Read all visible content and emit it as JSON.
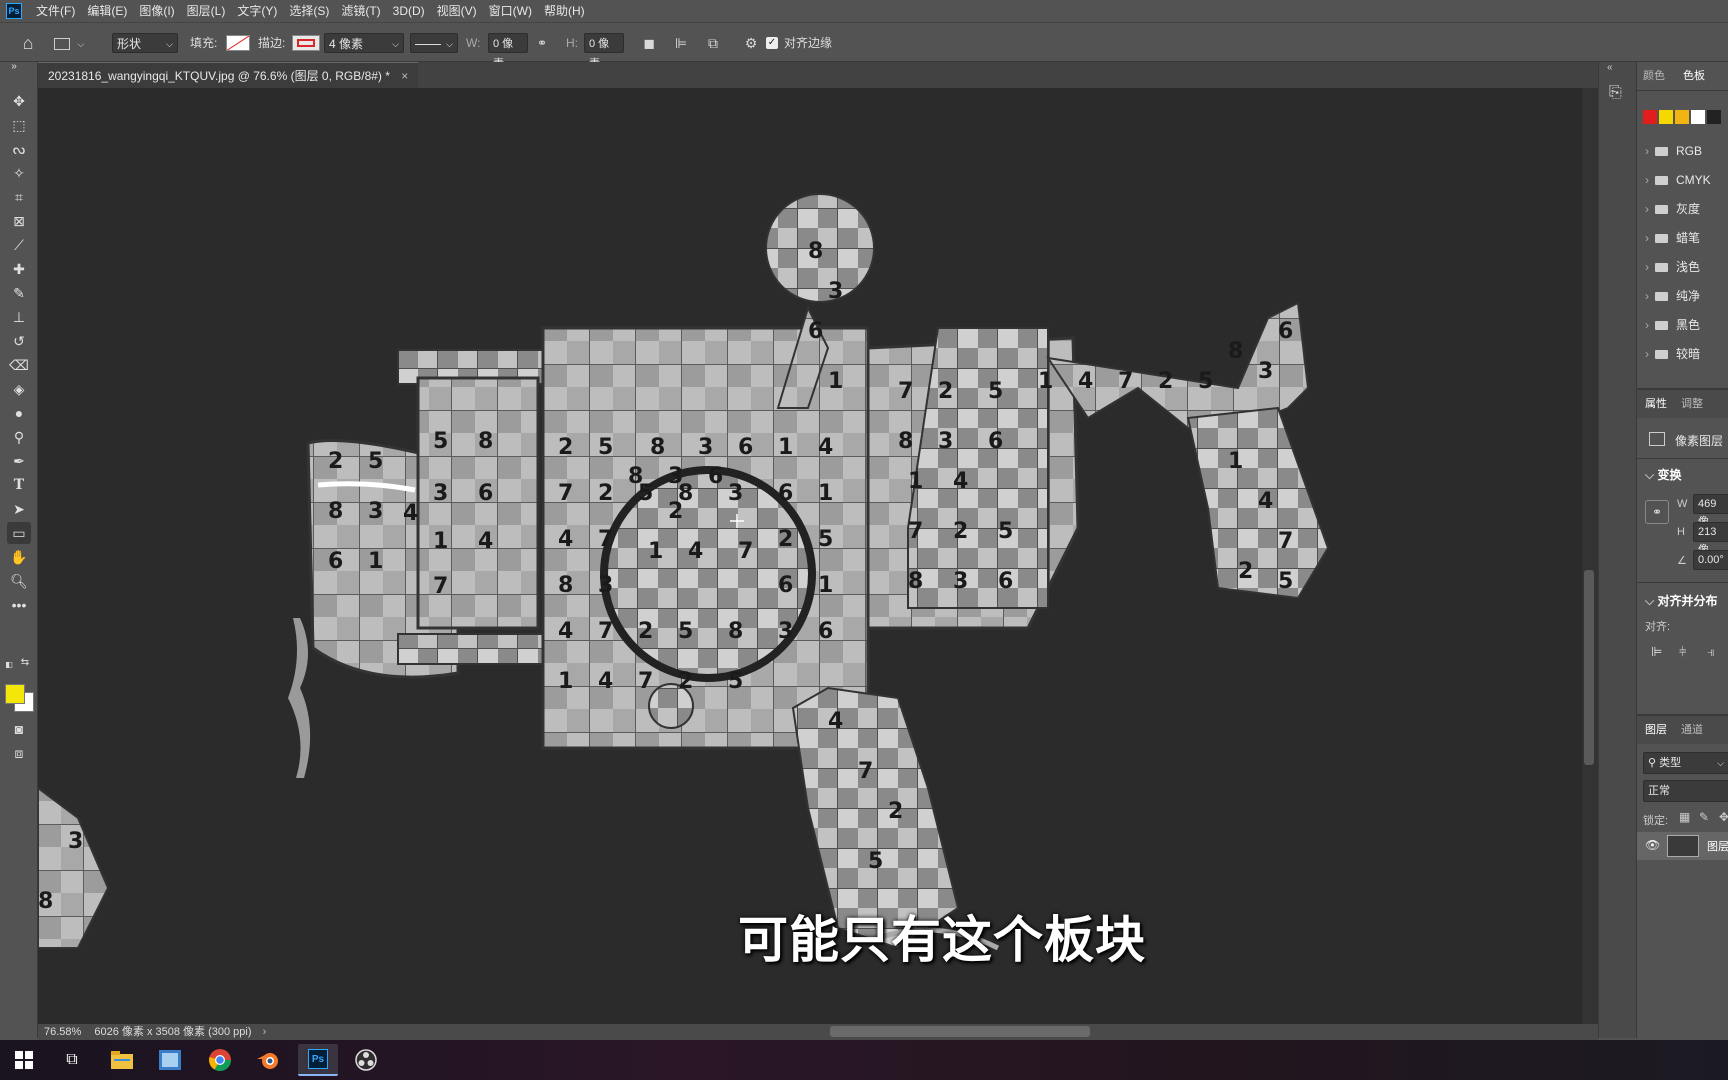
{
  "app": {
    "logo_text": "Ps"
  },
  "menu": [
    "文件(F)",
    "编辑(E)",
    "图像(I)",
    "图层(L)",
    "文字(Y)",
    "选择(S)",
    "滤镜(T)",
    "3D(D)",
    "视图(V)",
    "窗口(W)",
    "帮助(H)"
  ],
  "options": {
    "shape_mode": "形状",
    "fill_label": "填充:",
    "stroke_label": "描边:",
    "stroke_width": "4 像素",
    "w_label": "W:",
    "w_value": "0 像素",
    "h_label": "H:",
    "h_value": "0 像素",
    "align_edges_label": "对齐边缘",
    "align_edges_checked": true,
    "stroke_color": "#d62828"
  },
  "document": {
    "tab_title": "20231816_wangyingqi_KTQUV.jpg @ 76.6% (图层 0, RGB/8#) *",
    "close_glyph": "×"
  },
  "status": {
    "zoom": "76.58%",
    "doc_size": "6026 像素 x 3508 像素 (300 ppi)"
  },
  "subtitle": "可能只有这个板块",
  "right_panel": {
    "tabs_top": [
      "颜色",
      "色板"
    ],
    "swatch_colors": [
      "#e21d1d",
      "#f5d800",
      "#f2b413",
      "#ffffff",
      "#222222"
    ],
    "swatch_groups": [
      "RGB",
      "CMYK",
      "灰度",
      "蜡笔",
      "浅色",
      "纯净",
      "黑色",
      "较暗"
    ],
    "props_tabs": [
      "属性",
      "调整"
    ],
    "layer_type": "像素图层",
    "transform_title": "变换",
    "w_label": "W",
    "w_value": "469 像",
    "h_label": "H",
    "h_value": "213 像",
    "angle_value": "0.00°",
    "align_title": "对齐并分布",
    "align_label": "对齐:",
    "layers_tabs": [
      "图层",
      "通道"
    ],
    "filter_label": "类型",
    "blend_mode": "正常",
    "lock_label": "锁定:",
    "layer_name": "图层"
  },
  "colors": {
    "foreground": "#f5e60a",
    "background": "#ffffff",
    "accent": "#31a8ff"
  },
  "toolbar_icons": [
    "move-icon",
    "marquee-icon",
    "lasso-icon",
    "magic-wand-icon",
    "crop-icon",
    "frame-icon",
    "eyedropper-icon",
    "healing-icon",
    "brush-icon",
    "stamp-icon",
    "history-brush-icon",
    "eraser-icon",
    "bucket-icon",
    "blur-icon",
    "dodge-icon",
    "pen-icon",
    "type-icon",
    "path-select-icon",
    "rectangle-icon",
    "hand-icon",
    "zoom-icon",
    "more-icon"
  ],
  "taskbar": [
    "windows-start",
    "task-view",
    "file-explorer",
    "photos",
    "chrome",
    "blender",
    "photoshop",
    "obs"
  ],
  "canvas_numbers": [
    "1",
    "2",
    "3",
    "4",
    "5",
    "6",
    "7",
    "8"
  ]
}
